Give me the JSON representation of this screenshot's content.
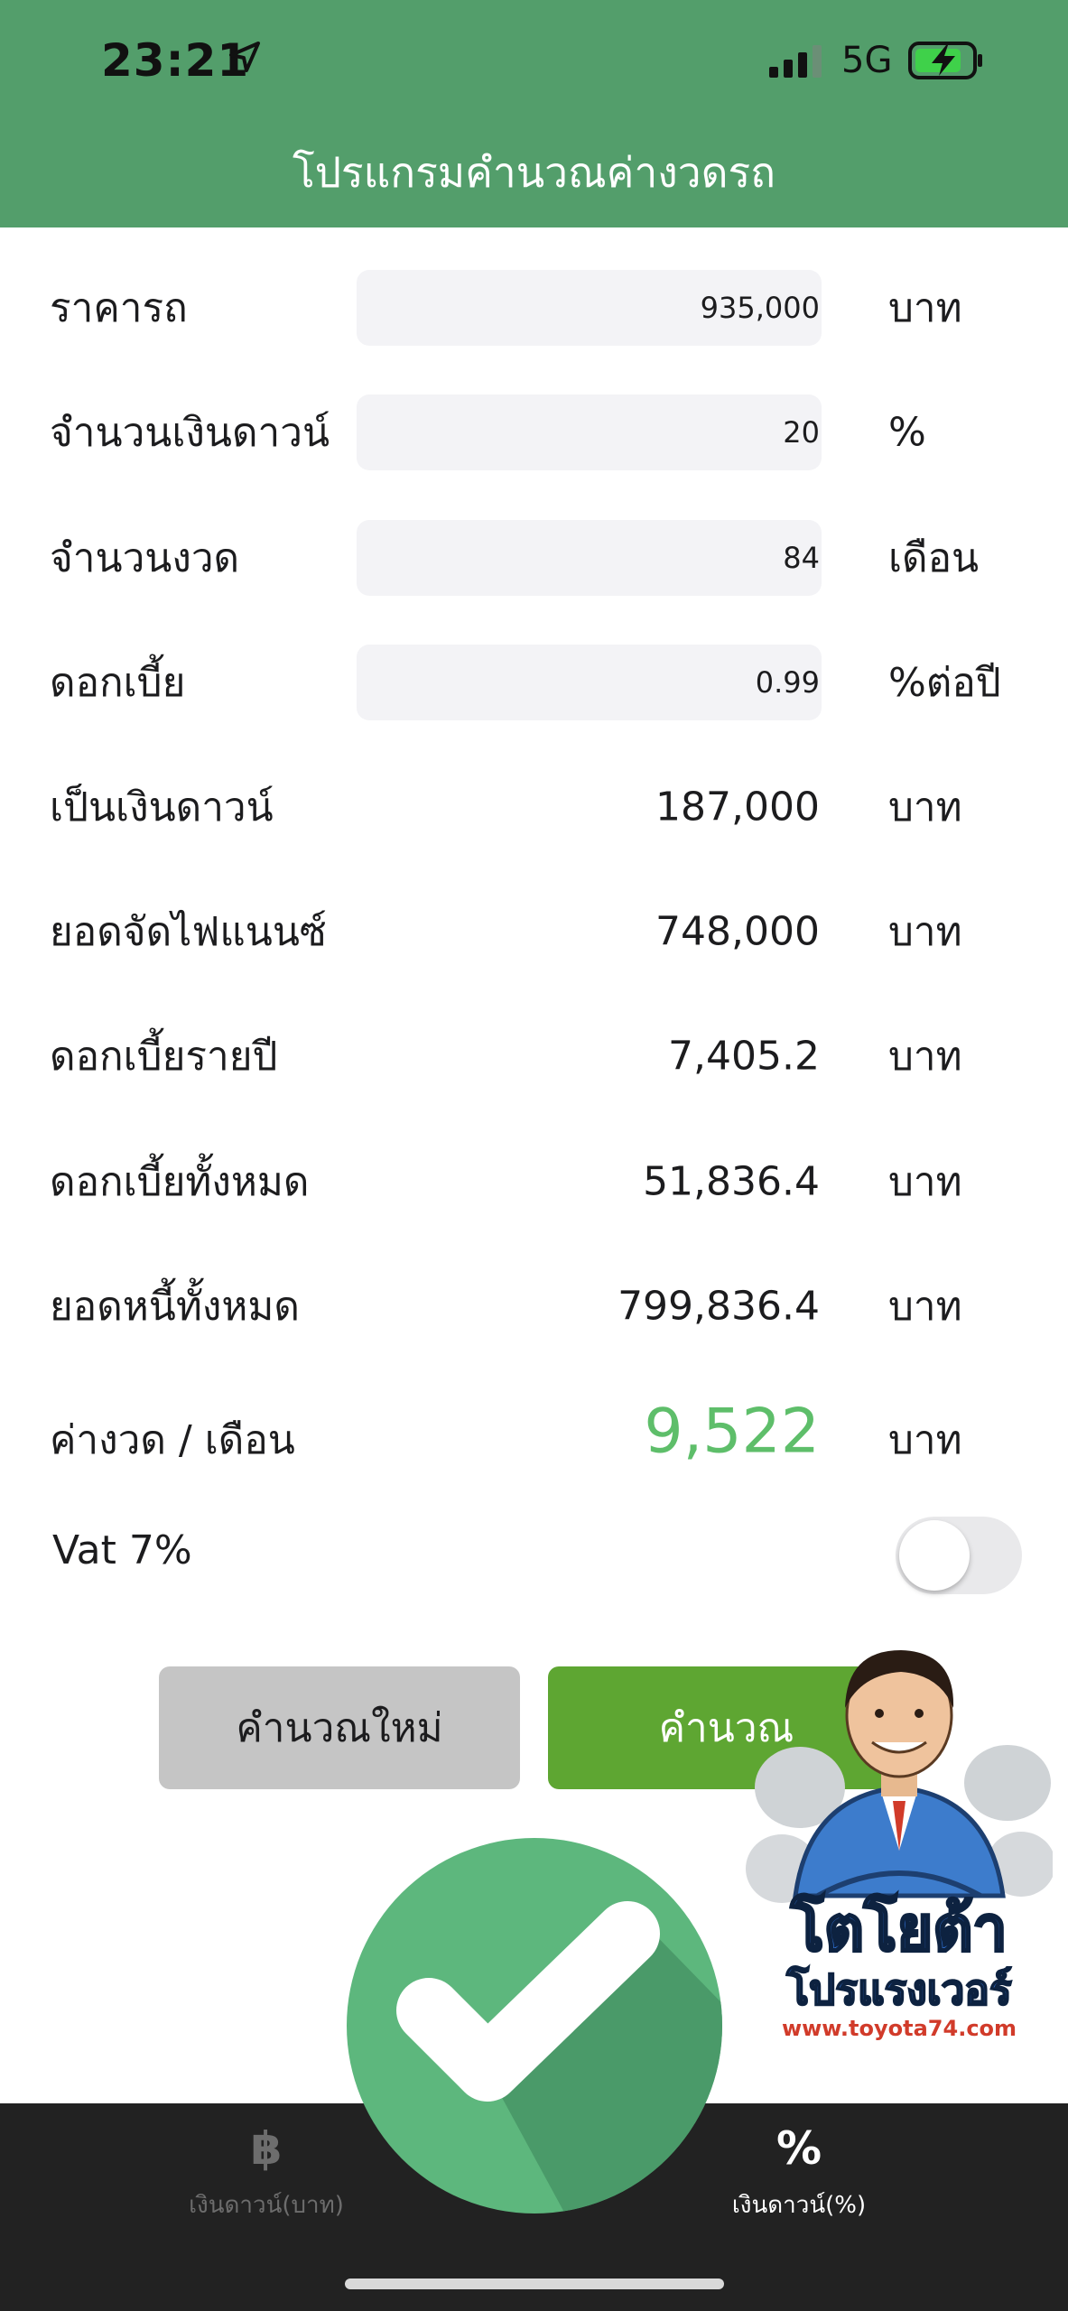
{
  "status_bar": {
    "time": "23:21",
    "network": "5G"
  },
  "header": {
    "title": "โปรแกรมคำนวณค่างวดรถ"
  },
  "inputs": [
    {
      "label": "ราคารถ",
      "value": "935,000",
      "unit": "บาท"
    },
    {
      "label": "จำนวนเงินดาวน์",
      "value": "20",
      "unit": "%"
    },
    {
      "label": "จำนวนงวด",
      "value": "84",
      "unit": "เดือน"
    },
    {
      "label": "ดอกเบี้ย",
      "value": "0.99",
      "unit": "%ต่อปี"
    }
  ],
  "results": [
    {
      "label": "เป็นเงินดาวน์",
      "value": "187,000",
      "unit": "บาท"
    },
    {
      "label": "ยอดจัดไฟแนนซ์",
      "value": "748,000",
      "unit": "บาท"
    },
    {
      "label": "ดอกเบี้ยรายปี",
      "value": "7,405.2",
      "unit": "บาท"
    },
    {
      "label": "ดอกเบี้ยทั้งหมด",
      "value": "51,836.4",
      "unit": "บาท"
    },
    {
      "label": "ยอดหนี้ทั้งหมด",
      "value": "799,836.4",
      "unit": "บาท"
    }
  ],
  "monthly": {
    "label": "ค่างวด / เดือน",
    "value": "9,522",
    "unit": "บาท"
  },
  "vat": {
    "label": "Vat 7%",
    "enabled": false
  },
  "buttons": {
    "reset": "คำนวณใหม่",
    "calculate": "คำนวณ"
  },
  "tabs": [
    {
      "icon": "฿",
      "label": "เงินดาวน์(บาท)",
      "active": false
    },
    {
      "icon": "%",
      "label": "เงินดาวน์(%)",
      "active": true
    }
  ],
  "overlay": {
    "logo_text_1": "โตโยต้า",
    "logo_text_2": "โปรแรงเวอร์",
    "logo_url": "www.toyota74.com"
  },
  "colors": {
    "header": "#539e6b",
    "accent_green": "#5ea632",
    "monthly_value": "#5ebe6a",
    "tabbar": "#222222"
  }
}
